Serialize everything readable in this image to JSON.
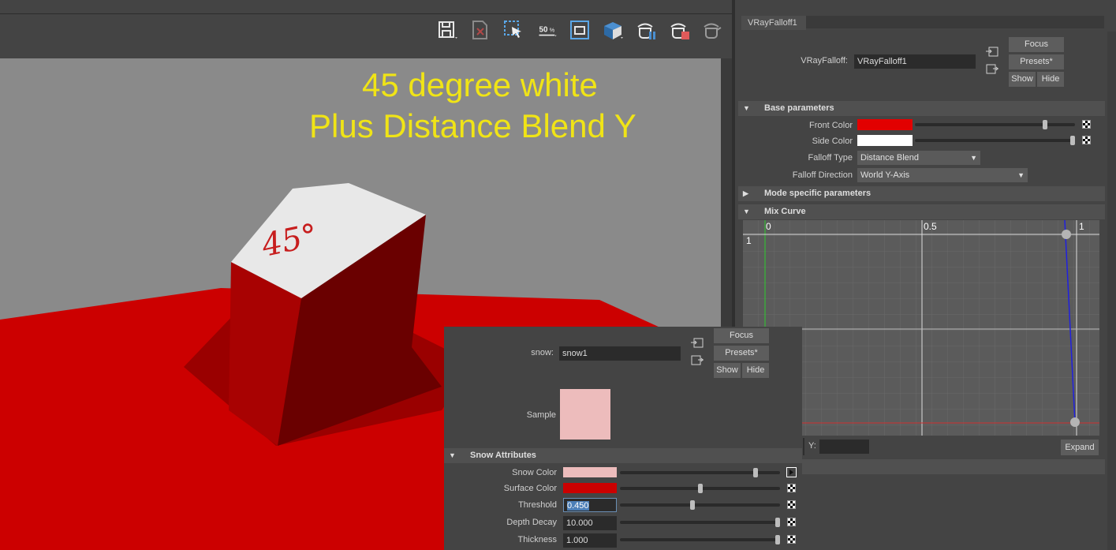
{
  "viewport": {
    "overlay_line1": "45 degree white",
    "overlay_line2": "Plus Distance Blend Y",
    "top_label": "45°",
    "colors": {
      "background": "#8a8a8a",
      "plane": "#cc0000",
      "overlay_text": "#f0e416"
    },
    "toolbar": [
      {
        "name": "save-icon"
      },
      {
        "name": "delete-icon"
      },
      {
        "name": "region-select-icon"
      },
      {
        "name": "zoom-50-icon",
        "label": "50%"
      },
      {
        "name": "frame-icon"
      },
      {
        "name": "render-region-icon"
      },
      {
        "name": "teapot-pause-icon"
      },
      {
        "name": "teapot-stop-icon"
      },
      {
        "name": "teapot-icon"
      }
    ]
  },
  "attribute_editor": {
    "tab_label": "VRayFalloff1",
    "name_label": "VRayFalloff:",
    "name_value": "VRayFalloff1",
    "focus_label": "Focus",
    "presets_label": "Presets*",
    "show_label": "Show",
    "hide_label": "Hide",
    "base_section": "Base parameters",
    "front_color_label": "Front Color",
    "front_color": "#e20000",
    "front_slider": 0.82,
    "side_color_label": "Side Color",
    "side_color": "#ffffff",
    "side_slider": 1.0,
    "falloff_type_label": "Falloff Type",
    "falloff_type_value": "Distance Blend",
    "falloff_direction_label": "Falloff Direction",
    "falloff_direction_value": "World Y-Axis",
    "mode_section": "Mode specific parameters",
    "mix_section": "Mix Curve",
    "graph": {
      "x0": "0",
      "xmid": "0.5",
      "x1": "1",
      "y1": "1"
    },
    "y_label": "Y:",
    "expand_label": "Expand"
  },
  "snow": {
    "name_label": "snow:",
    "name_value": "snow1",
    "focus_label": "Focus",
    "presets_label": "Presets*",
    "show_label": "Show",
    "hide_label": "Hide",
    "sample_label": "Sample",
    "sample_color": "#edbcbc",
    "section": "Snow Attributes",
    "snow_color_label": "Snow Color",
    "snow_color": "#edbcbc",
    "snow_slider": 0.86,
    "surface_color_label": "Surface Color",
    "surface_color": "#cc0000",
    "surface_slider": 0.5,
    "threshold_label": "Threshold",
    "threshold_value": "0.450",
    "threshold_slider": 0.45,
    "depth_decay_label": "Depth Decay",
    "depth_decay_value": "10.000",
    "depth_slider": 1.0,
    "thickness_label": "Thickness",
    "thickness_value": "1.000",
    "thickness_slider": 1.0
  }
}
